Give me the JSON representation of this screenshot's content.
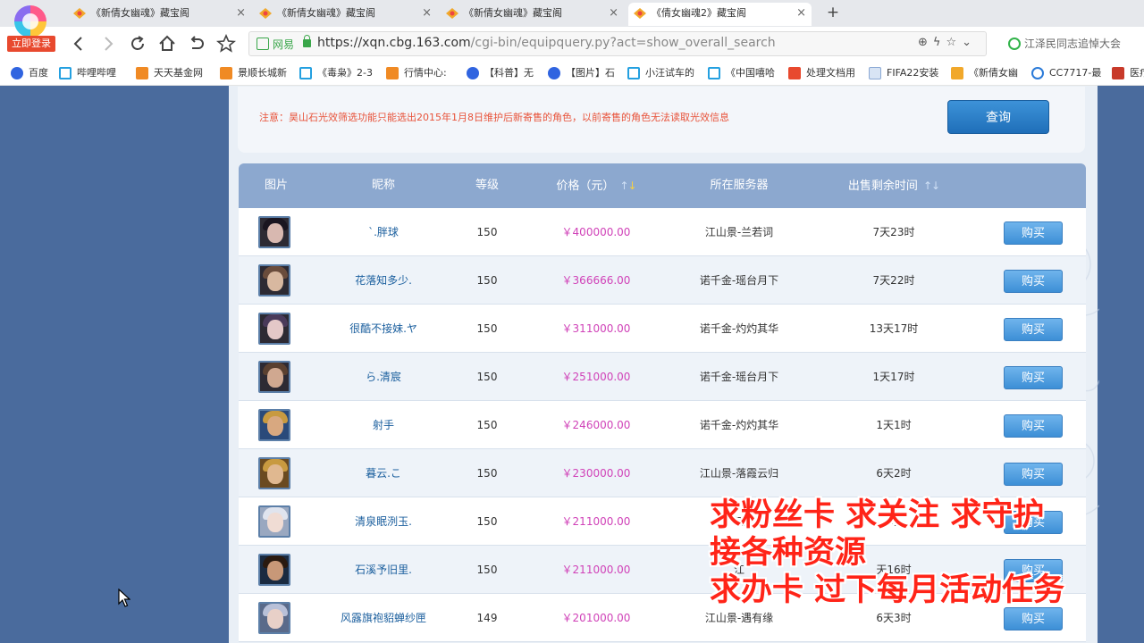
{
  "browser": {
    "login_badge": "立即登录",
    "tabs": [
      {
        "title": "《新倩女幽魂》藏宝阁",
        "active": false
      },
      {
        "title": "《新倩女幽魂》藏宝阁",
        "active": false
      },
      {
        "title": "《新倩女幽魂》藏宝阁",
        "active": false
      },
      {
        "title": "《倩女幽魂2》藏宝阁",
        "active": true
      }
    ],
    "new_tab": "+",
    "security_label": "网易",
    "url_host": "https://xqn.cbg.163.com",
    "url_path": "/cgi-bin/equipquery.py?act=show_overall_search",
    "search_text": "江泽民同志追悼大会",
    "bookmarks": [
      "百度",
      "哔哩哔哩",
      "天天基金网",
      "景顺长城新",
      "《毒枭》2-3",
      "行情中心:",
      "【科普】无",
      "【图片】石",
      "小汪试车的",
      "《中国嘻哈",
      "处理文档用",
      "FIFA22安装",
      "《新倩女幽",
      "CC7717-最",
      "医疗"
    ]
  },
  "notice": {
    "message": "注意：昊山石光效筛选功能只能选出2015年1月8日维护后新寄售的角色，以前寄售的角色无法读取光效信息",
    "query_button": "查询"
  },
  "table": {
    "headers": {
      "image": "图片",
      "name": "昵称",
      "level": "等级",
      "price": "价格（元）",
      "server": "所在服务器",
      "time": "出售剩余时间"
    },
    "buy_label": "购买",
    "rows": [
      {
        "name": "`.胖球",
        "level": "150",
        "price": "￥400000.00",
        "server": "江山景-兰若词",
        "time": "7天23时"
      },
      {
        "name": "花落知多少.",
        "level": "150",
        "price": "￥366666.00",
        "server": "诺千金-瑶台月下",
        "time": "7天22时"
      },
      {
        "name": "很酷不接妹.ヤ",
        "level": "150",
        "price": "￥311000.00",
        "server": "诺千金-灼灼其华",
        "time": "13天17时"
      },
      {
        "name": "ら.清宸",
        "level": "150",
        "price": "￥251000.00",
        "server": "诺千金-瑶台月下",
        "time": "1天17时"
      },
      {
        "name": "射手",
        "level": "150",
        "price": "￥246000.00",
        "server": "诺千金-灼灼其华",
        "time": "1天1时"
      },
      {
        "name": "暮云.こ",
        "level": "150",
        "price": "￥230000.00",
        "server": "江山景-落霞云归",
        "time": "6天2时"
      },
      {
        "name": "清泉眠洌玉.",
        "level": "150",
        "price": "￥211000.00",
        "server": "江",
        "time": "时"
      },
      {
        "name": "石溪予旧里.",
        "level": "150",
        "price": "￥211000.00",
        "server": "江",
        "time": "天16时"
      },
      {
        "name": "风露旗袍貂蝉纱匣",
        "level": "149",
        "price": "￥201000.00",
        "server": "江山景-遇有缘",
        "time": "6天3时"
      }
    ]
  },
  "overlay": {
    "line1": "求粉丝卡  求关注  求守护",
    "line2": "接各种资源",
    "line3": "求办卡 过下每月活动任务"
  },
  "colors": {
    "page_bg": "#4a6b9d",
    "header_bg": "#8ca8cf",
    "price": "#d042b8",
    "name_link": "#1b5f9e",
    "notice": "#e8533a",
    "overlay_text": "#ff2418"
  }
}
